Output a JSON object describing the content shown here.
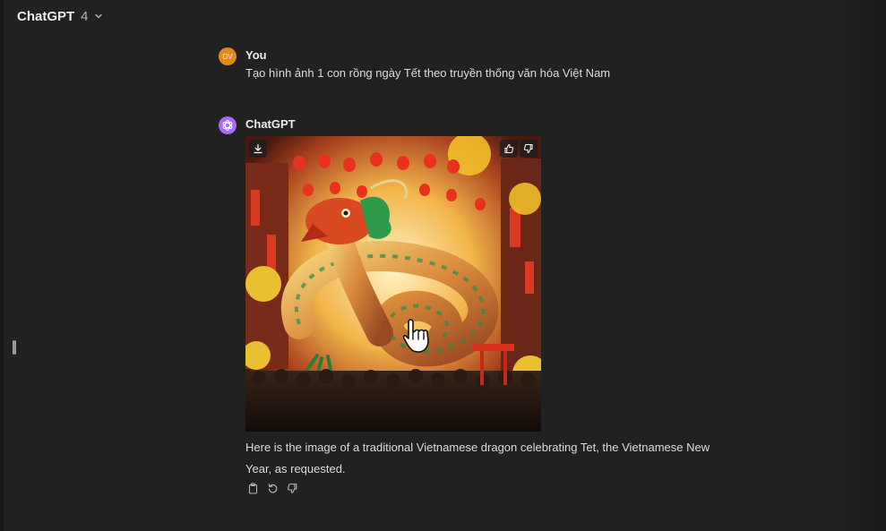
{
  "header": {
    "model_name": "ChatGPT",
    "model_version": "4"
  },
  "conversation": {
    "user_message": {
      "avatar_initials": "DV",
      "author": "You",
      "text": "Tạo hình ảnh 1 con rồng ngày Tết theo truyền thống văn hóa Việt Nam"
    },
    "assistant_message": {
      "author": "ChatGPT",
      "text": "Here is the image of a traditional Vietnamese dragon celebrating Tet, the Vietnamese New Year, as requested."
    }
  },
  "icons": {
    "model_chevron": "chevron-down-icon",
    "download": "download-icon",
    "image_like": "thumbs-up-icon",
    "image_dislike": "thumbs-down-icon",
    "copy": "clipboard-icon",
    "regenerate": "refresh-icon",
    "bad_response": "thumbs-down-icon",
    "assistant_logo": "openai-logo-icon",
    "cursor": "hand-pointer-icon"
  },
  "colors": {
    "background": "#212121",
    "user_avatar": "#e08a1e",
    "assistant_avatar": "#ab68ff",
    "text_primary": "#ececec",
    "text_secondary": "#b4b4b4"
  }
}
